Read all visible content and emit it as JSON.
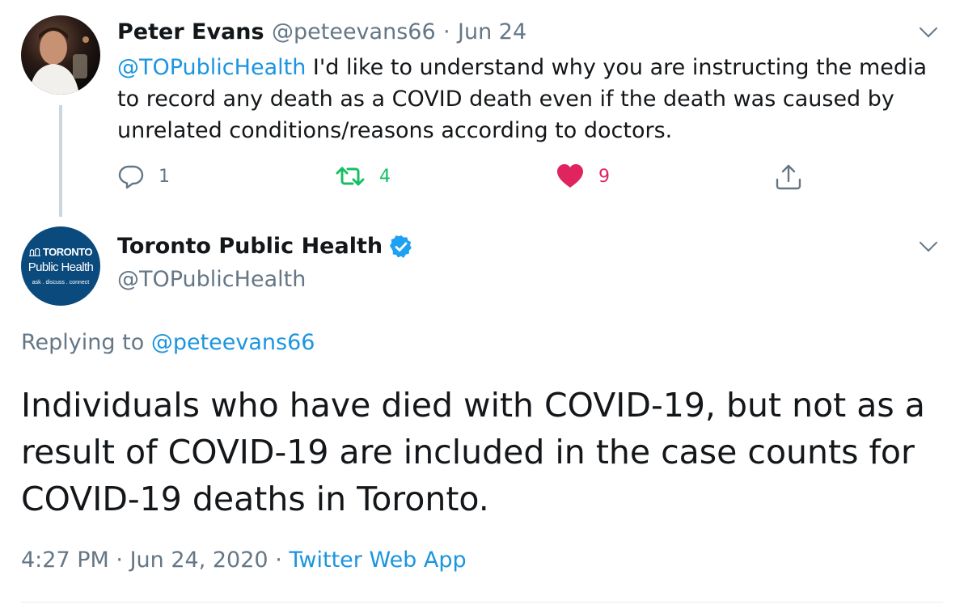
{
  "parent_tweet": {
    "author_name": "Peter Evans",
    "handle": "@peteevans66",
    "separator": "·",
    "date": "Jun 24",
    "mention": "@TOPublicHealth",
    "text": " I'd like to understand why you are instructing the media to record any death as a COVID death even if the death was caused by unrelated conditions/reasons according to doctors.",
    "replies": "1",
    "retweets": "4",
    "likes": "9",
    "colors": {
      "retweet": "#17bf63",
      "like": "#e0245e",
      "link": "#1b95e0"
    }
  },
  "main_tweet": {
    "author_name": "Toronto Public Health",
    "handle": "@TOPublicHealth",
    "avatar": {
      "line1": "TORONTO",
      "line2": "Public Health",
      "line3": "ask . discuss . connect",
      "background": "#0b4a7d"
    },
    "replying_prefix": "Replying to ",
    "replying_handle": "@peteevans66",
    "text": "Individuals who have died with COVID-19, but not as a result of COVID-19 are included in the case counts for COVID-19 deaths in Toronto.",
    "time": "4:27 PM",
    "separator": "·",
    "date": "Jun 24, 2020",
    "source": "Twitter Web App",
    "verified_color": "#1da1f2"
  }
}
